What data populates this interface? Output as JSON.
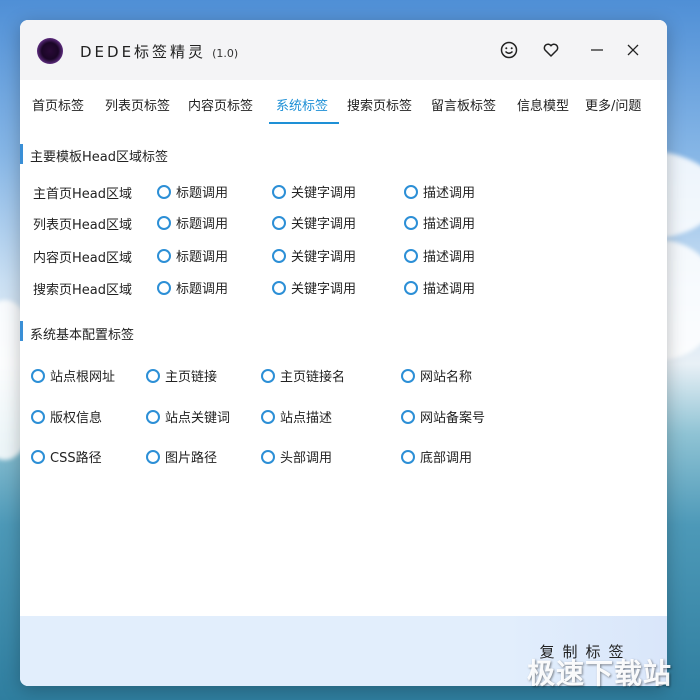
{
  "app": {
    "title": "DEDE标签精灵",
    "version": "(1.0)"
  },
  "titlebar_icons": [
    "smiley-icon",
    "heart-icon",
    "minimize-icon",
    "close-icon"
  ],
  "tabs": [
    {
      "label": "首页标签",
      "active": false
    },
    {
      "label": "列表页标签",
      "active": false
    },
    {
      "label": "内容页标签",
      "active": false
    },
    {
      "label": "系统标签",
      "active": true
    },
    {
      "label": "搜索页标签",
      "active": false
    },
    {
      "label": "留言板标签",
      "active": false
    },
    {
      "label": "信息模型",
      "active": false
    },
    {
      "label": "更多/问题",
      "active": false
    }
  ],
  "head_section": {
    "title": "主要模板Head区域标签",
    "rows": [
      {
        "label": "主首页Head区域",
        "options": [
          "标题调用",
          "关键字调用",
          "描述调用"
        ]
      },
      {
        "label": "列表页Head区域",
        "options": [
          "标题调用",
          "关键字调用",
          "描述调用"
        ]
      },
      {
        "label": "内容页Head区域",
        "options": [
          "标题调用",
          "关键字调用",
          "描述调用"
        ]
      },
      {
        "label": "搜索页Head区域",
        "options": [
          "标题调用",
          "关键字调用",
          "描述调用"
        ]
      }
    ]
  },
  "config_section": {
    "title": "系统基本配置标签",
    "rows": [
      [
        "站点根网址",
        "主页链接",
        "主页链接名",
        "网站名称"
      ],
      [
        "版权信息",
        "站点关键词",
        "站点描述",
        "网站备案号"
      ],
      [
        "CSS路径",
        "图片路径",
        "头部调用",
        "底部调用"
      ]
    ]
  },
  "footer": {
    "copy_button": "复制标签"
  },
  "watermark": "极速下载站",
  "colors": {
    "accent": "#1e90d6",
    "radio_border": "#2c8fd6",
    "footer_bg": "#e2eefc"
  }
}
